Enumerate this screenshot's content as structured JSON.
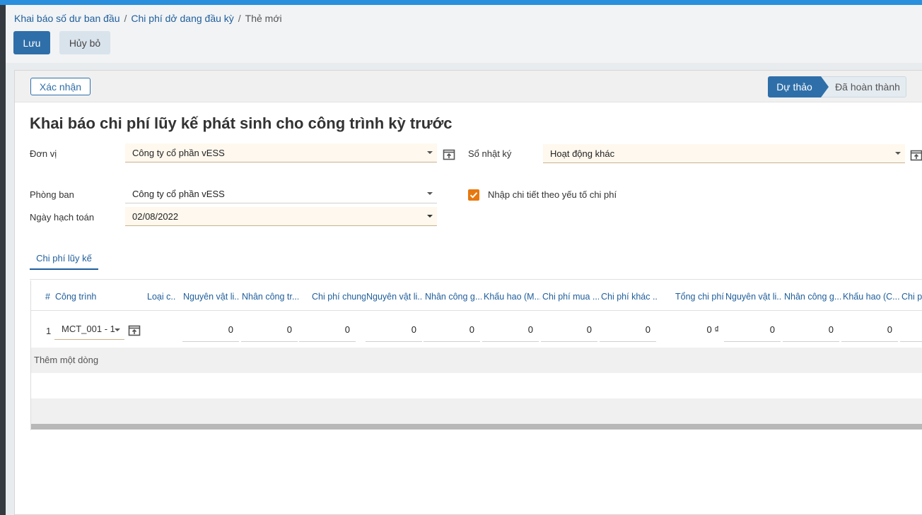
{
  "breadcrumb": {
    "item1": "Khai báo số dư ban đầu",
    "item2": "Chi phí dở dang đầu kỳ",
    "current": "Thẻ mới",
    "separator": "/"
  },
  "actions": {
    "save": "Lưu",
    "cancel": "Hủy bỏ"
  },
  "statusbar": {
    "confirm": "Xác nhận",
    "stages": [
      "Dự thảo",
      "Đã hoàn thành"
    ],
    "active_stage": "Dự thảo"
  },
  "form": {
    "title": "Khai báo chi phí lũy kế phát sinh cho công trình kỳ trước",
    "don_vi": {
      "label": "Đơn vị",
      "value": "Công ty cổ phần vESS"
    },
    "so_nhat_ky": {
      "label": "Sổ nhật ký",
      "value": "Hoạt động khác"
    },
    "phong_ban": {
      "label": "Phòng ban",
      "value": "Công ty cổ phần vESS"
    },
    "ngay_hach_toan": {
      "label": "Ngày hạch toán",
      "value": "02/08/2022"
    },
    "chi_tiet": {
      "label": "Nhập chi tiết theo yếu tố chi phí",
      "checked": true
    }
  },
  "tabs": [
    "Chi phí lũy kế"
  ],
  "table": {
    "headers": [
      "#",
      "Công trình",
      "Loại c...",
      "Nguyên vật li...",
      "Nhân công tr...",
      "Chi phí chung",
      "Nguyên vật li...",
      "Nhân công g...",
      "Khấu hao (M...",
      "Chi phí mua ...",
      "Chi phí khác ...",
      "Tổng chi phí",
      "Nguyên vật li...",
      "Nhân công g...",
      "Khấu hao (C...",
      "Chi ph"
    ],
    "rows": [
      {
        "num": "1",
        "project": "MCT_001 - 1",
        "values": [
          "0",
          "0",
          "0",
          "0",
          "0",
          "0",
          "0",
          "0",
          "0 ₫",
          "0",
          "0",
          "0",
          ""
        ]
      }
    ],
    "add_row": "Thêm một dòng"
  },
  "colors": {
    "primary": "#2f6fa9",
    "accent": "#e8780e",
    "topbar": "#2a8fdc"
  },
  "icons": [
    "caret-down-icon",
    "external-link-icon",
    "check-icon"
  ]
}
